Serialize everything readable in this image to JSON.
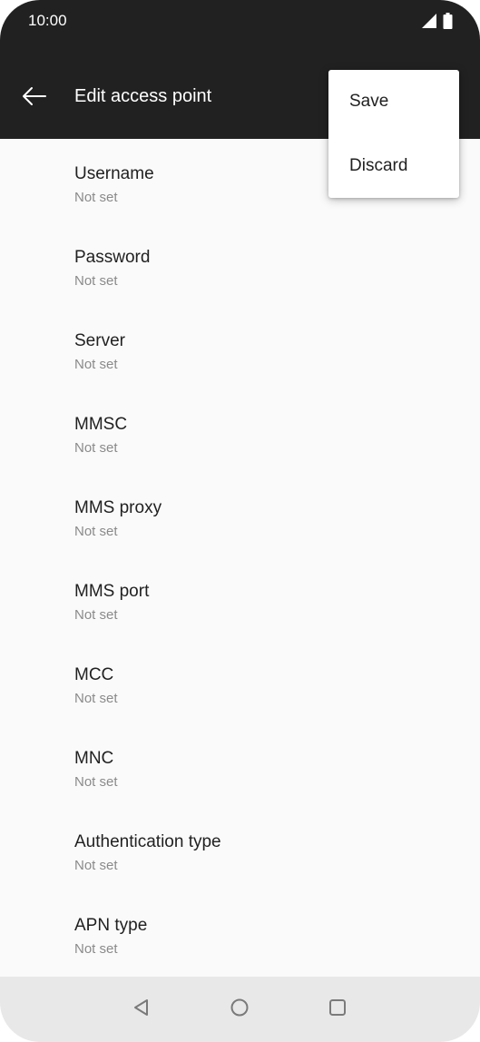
{
  "status_bar": {
    "time": "10:00",
    "icons": [
      "signal-icon",
      "battery-icon"
    ]
  },
  "app_bar": {
    "back_icon": "arrow-left-icon",
    "title": "Edit access point"
  },
  "fields": [
    {
      "title": "Username",
      "summary": "Not set"
    },
    {
      "title": "Password",
      "summary": "Not set"
    },
    {
      "title": "Server",
      "summary": "Not set"
    },
    {
      "title": "MMSC",
      "summary": "Not set"
    },
    {
      "title": "MMS proxy",
      "summary": "Not set"
    },
    {
      "title": "MMS port",
      "summary": "Not set"
    },
    {
      "title": "MCC",
      "summary": "Not set"
    },
    {
      "title": "MNC",
      "summary": "Not set"
    },
    {
      "title": "Authentication type",
      "summary": "Not set"
    },
    {
      "title": "APN type",
      "summary": "Not set"
    }
  ],
  "overflow_menu": {
    "items": [
      "Save",
      "Discard"
    ]
  },
  "nav_bar": {
    "icons": [
      "back-triangle-icon",
      "home-circle-icon",
      "recents-square-icon"
    ]
  },
  "colors": {
    "app_bar": "#212121",
    "background": "#fafafa",
    "nav_bar": "#e8e8e8",
    "title_text": "#212121",
    "summary_text": "#8a8a8a"
  }
}
